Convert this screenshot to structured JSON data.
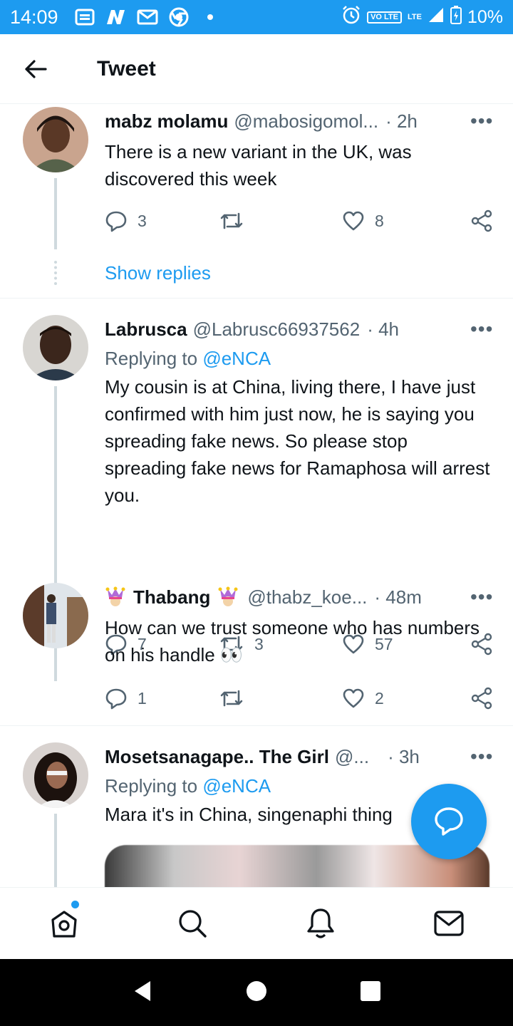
{
  "status_bar": {
    "time": "14:09",
    "network": "LTE",
    "volte": "VO LTE",
    "battery": "10%"
  },
  "header": {
    "title": "Tweet"
  },
  "tweets": [
    {
      "name": "mabz molamu",
      "handle": "@mabosigomol...",
      "time": "· 2h",
      "text": "There is a new variant in the UK, was discovered this week",
      "replies": "3",
      "retweets": "",
      "likes": "8"
    },
    {
      "name": "Labrusca",
      "handle": "@Labrusc66937562",
      "time": "· 4h",
      "replying_prefix": "Replying to",
      "replying_mention": "@eNCA",
      "text": "My cousin is at China, living there, I have just confirmed with him just now, he is saying you spreading fake news. So please stop spreading fake news for Ramaphosa will arrest you.",
      "replies": "7",
      "retweets": "3",
      "likes": "57"
    },
    {
      "name": "Thabang",
      "handle": "@thabz_koe...",
      "time": "· 48m",
      "text": "How can we trust someone who has numbers on his handle 👀",
      "replies": "1",
      "retweets": "",
      "likes": "2"
    },
    {
      "name": "Mosetsanagape.. The Girl",
      "handle": "@...",
      "time": "· 3h",
      "replying_prefix": "Replying to",
      "replying_mention": "@eNCA",
      "text": "Mara it's in China, singenaphi thing"
    }
  ],
  "show_replies_label": "Show replies",
  "more_label": "•••",
  "colors": {
    "accent": "#1d9bf0",
    "secondary_text": "#536471",
    "thread_line": "#cfd9de"
  }
}
